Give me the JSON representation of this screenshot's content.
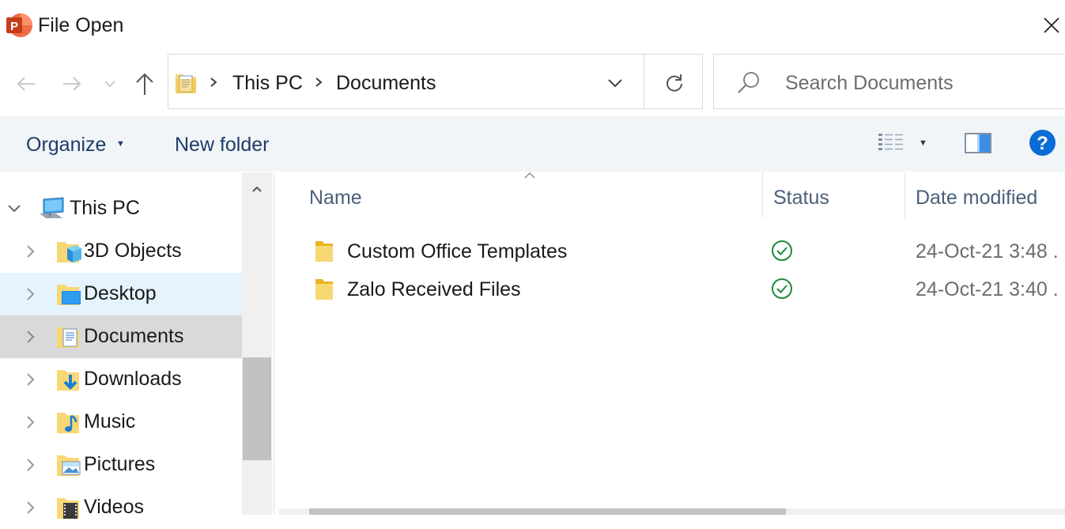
{
  "window": {
    "title": "File Open",
    "accent": "#c43e1c"
  },
  "nav": {
    "breadcrumb": [
      "This PC",
      "Documents"
    ]
  },
  "search": {
    "placeholder": "Search Documents"
  },
  "toolbar": {
    "organize": "Organize",
    "new_folder": "New folder",
    "help_label": "?"
  },
  "tree": [
    {
      "label": "This PC",
      "icon": "computer-icon",
      "state": "expanded"
    },
    {
      "label": "3D Objects",
      "icon": "3d-objects-folder-icon",
      "state": "collapsed"
    },
    {
      "label": "Desktop",
      "icon": "desktop-folder-icon",
      "state": "hover"
    },
    {
      "label": "Documents",
      "icon": "documents-folder-icon",
      "state": "selected"
    },
    {
      "label": "Downloads",
      "icon": "downloads-folder-icon",
      "state": "collapsed"
    },
    {
      "label": "Music",
      "icon": "music-folder-icon",
      "state": "collapsed"
    },
    {
      "label": "Pictures",
      "icon": "pictures-folder-icon",
      "state": "collapsed"
    },
    {
      "label": "Videos",
      "icon": "videos-folder-icon",
      "state": "collapsed"
    }
  ],
  "columns": {
    "name": "Name",
    "status": "Status",
    "date": "Date modified"
  },
  "files": [
    {
      "name": "Custom Office Templates",
      "status": "synced",
      "date": "24-Oct-21 3:48 ."
    },
    {
      "name": "Zalo Received Files",
      "status": "synced",
      "date": "24-Oct-21 3:40 ."
    }
  ]
}
